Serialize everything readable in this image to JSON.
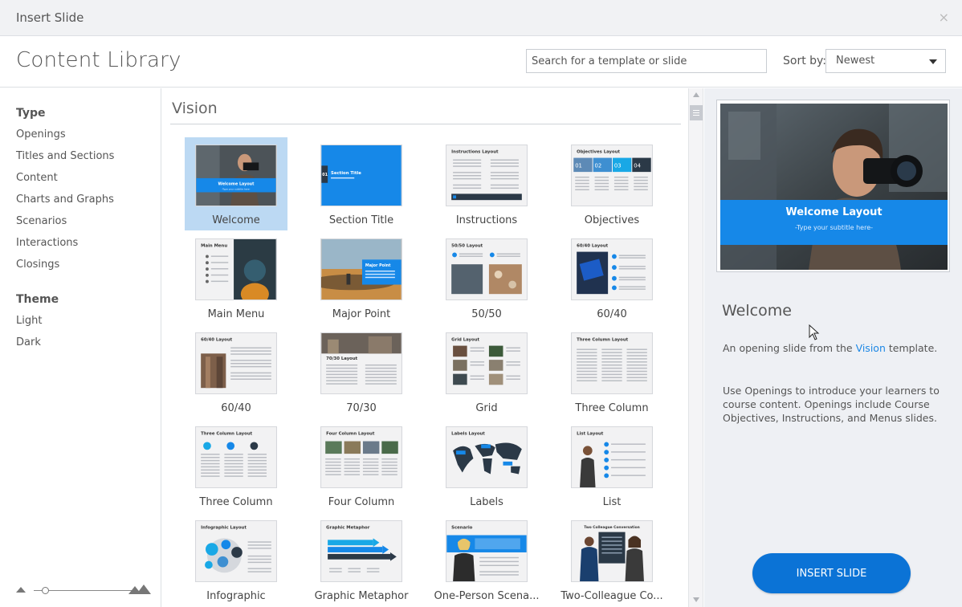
{
  "window": {
    "title": "Insert Slide",
    "close_icon": "×"
  },
  "header": {
    "title": "Content Library",
    "search_placeholder": "Search for a template or slide",
    "sort_label": "Sort by:",
    "sort_value": "Newest"
  },
  "sidebar": {
    "type_heading": "Type",
    "types": [
      "Openings",
      "Titles and Sections",
      "Content",
      "Charts and Graphs",
      "Scenarios",
      "Interactions",
      "Closings"
    ],
    "theme_heading": "Theme",
    "themes": [
      "Light",
      "Dark"
    ]
  },
  "gallery": {
    "section": "Vision",
    "tiles": [
      {
        "label": "Welcome",
        "caption": "Welcome Layout",
        "sub": "-Type your subtitle here-",
        "kind": "welcome"
      },
      {
        "label": "Section Title",
        "caption": "Section Title",
        "num": "01",
        "kind": "section"
      },
      {
        "label": "Instructions",
        "caption": "Instructions Layout",
        "kind": "instructions"
      },
      {
        "label": "Objectives",
        "caption": "Objectives Layout",
        "nums": [
          "01",
          "02",
          "03",
          "04"
        ],
        "kind": "objectives"
      },
      {
        "label": "Main Menu",
        "caption": "Main Menu",
        "kind": "menu"
      },
      {
        "label": "Major Point",
        "caption": "Major Point",
        "kind": "major"
      },
      {
        "label": "50/50",
        "caption": "50/50 Layout",
        "kind": "fifty"
      },
      {
        "label": "60/40",
        "caption": "60/40 Layout",
        "kind": "sixty"
      },
      {
        "label": "60/40",
        "caption": "60/40 Layout",
        "kind": "sixtyb"
      },
      {
        "label": "70/30",
        "caption": "70/30 Layout",
        "kind": "seventy"
      },
      {
        "label": "Grid",
        "caption": "Grid Layout",
        "kind": "grid"
      },
      {
        "label": "Three Column",
        "caption": "Three Column Layout",
        "kind": "threecol"
      },
      {
        "label": "Three Column",
        "caption": "Three Column Layout",
        "kind": "threecolicons"
      },
      {
        "label": "Four Column",
        "caption": "Four Column Layout",
        "kind": "fourcol"
      },
      {
        "label": "Labels",
        "caption": "Labels Layout",
        "kind": "labels"
      },
      {
        "label": "List",
        "caption": "List Layout",
        "kind": "list"
      },
      {
        "label": "Infographic",
        "caption": "Infographic Layout",
        "kind": "infographic"
      },
      {
        "label": "Graphic Metaphor",
        "caption": "Graphic Metaphor",
        "kind": "metaphor"
      },
      {
        "label": "One-Person  Scena...",
        "caption": "Scenario",
        "kind": "scenario"
      },
      {
        "label": "Two-Colleague  Co...",
        "caption": "Two Colleague Conversation",
        "kind": "colleague"
      }
    ]
  },
  "preview": {
    "title": "Welcome",
    "slide_title": "Welcome Layout",
    "slide_subtitle": "-Type your subtitle here-",
    "desc_prefix": "An opening slide from the ",
    "desc_link": "Vision",
    "desc_suffix": " template.",
    "description": "Use Openings to introduce your learners to course content. Openings include Course Objectives, Instructions, and Menus slides.",
    "insert_label": "INSERT SLIDE"
  },
  "colors": {
    "accent": "#0b73d6",
    "selected_tile": "#bcd9f3",
    "slide_blue": "#1688e8"
  }
}
